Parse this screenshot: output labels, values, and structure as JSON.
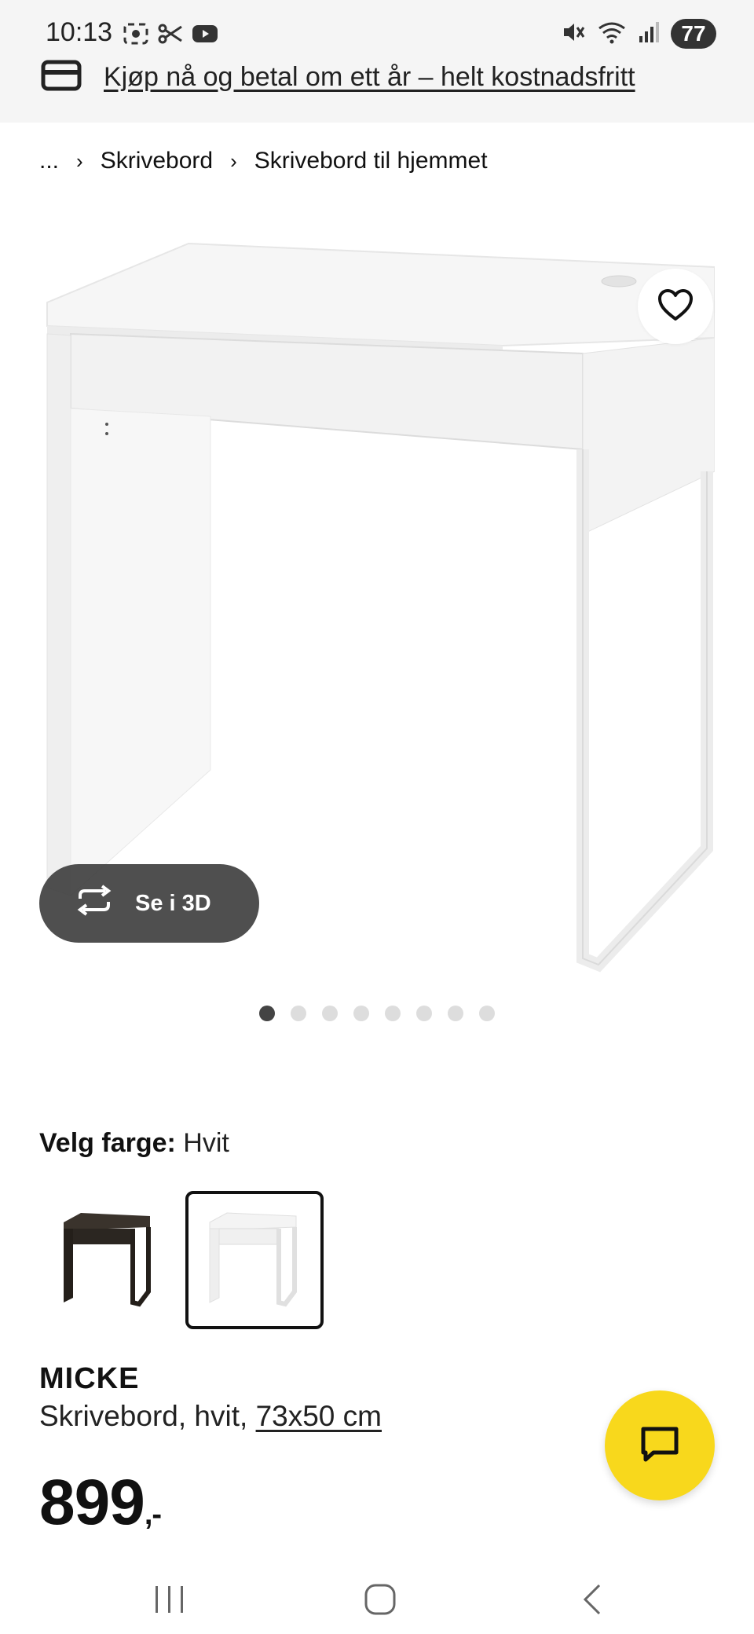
{
  "status_bar": {
    "time": "10:13",
    "battery": "77",
    "icons": [
      "screenshot-icon",
      "scissors-icon",
      "youtube-icon",
      "mute-icon",
      "wifi-icon",
      "signal-icon"
    ]
  },
  "banner": {
    "icon": "credit-card-icon",
    "text": "Kjøp nå og betal om ett år – helt kostnadsfritt"
  },
  "breadcrumb": {
    "ellipsis": "...",
    "items": [
      "Skrivebord",
      "Skrivebord til hjemmet"
    ]
  },
  "gallery": {
    "view_3d_label": "Se i 3D",
    "dot_count": 8,
    "active_dot": 0
  },
  "color": {
    "label": "Velg farge:",
    "value": "Hvit",
    "options": [
      {
        "name": "black-brown",
        "color": "#2b2621",
        "selected": false
      },
      {
        "name": "white",
        "color": "#f4f4f4",
        "selected": true
      }
    ]
  },
  "product": {
    "name": "MICKE",
    "description": "Skrivebord, hvit,",
    "dimensions": "73x50 cm",
    "price": "899",
    "price_suffix": ",-"
  },
  "colors": {
    "chat_fab": "#f8d81c",
    "banner_bg": "#f5f5f5"
  }
}
